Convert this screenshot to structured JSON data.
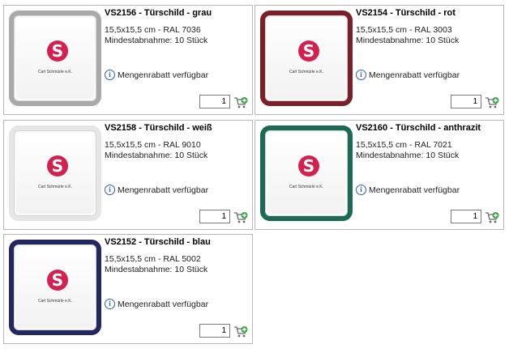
{
  "common": {
    "availability": "Mengenrabatt verfügbar",
    "min_order": "Mindestabnahme: 10 Stück",
    "company": "Carl Schmürle e.K."
  },
  "products": [
    {
      "sku_title": "VS2156 - Türschild - grau",
      "spec": "15,5x15,5 cm - RAL 7036",
      "qty": "1",
      "frame_color": "#a9a9a9"
    },
    {
      "sku_title": "VS2154 - Türschild - rot",
      "spec": "15,5x15,5 cm - RAL 3003",
      "qty": "1",
      "frame_color": "#7d1f27"
    },
    {
      "sku_title": "VS2158 - Türschild - weiß",
      "spec": "15,5x15,5 cm - RAL 9010",
      "qty": "1",
      "frame_color": "#e6e6e6"
    },
    {
      "sku_title": "VS2160 - Türschild - anthrazit",
      "spec": "15,5x15,5 cm - RAL 7021",
      "qty": "1",
      "frame_color": "#1a6a55"
    },
    {
      "sku_title": "VS2152 - Türschild - blau",
      "spec": "15,5x15,5 cm - RAL 5002",
      "qty": "1",
      "frame_color": "#22275f"
    }
  ]
}
